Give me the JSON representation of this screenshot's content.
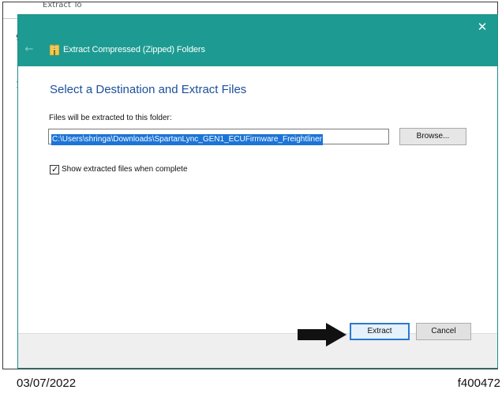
{
  "background": {
    "tab_text": "Extract To",
    "left_edge_chars": [
      "9",
      "1"
    ],
    "right_edge_char": "a"
  },
  "dialog": {
    "title": "Extract Compressed (Zipped) Folders",
    "close_symbol": "✕",
    "back_symbol": "←",
    "accent_color": "#1d9b92",
    "heading": "Select a Destination and Extract Files",
    "folder_label": "Files will be extracted to this folder:",
    "path_value": "C:\\Users\\shringa\\Downloads\\SpartanLync_GEN1_ECUFirmware_Freightliner",
    "browse_label": "Browse...",
    "show_files_label": "Show extracted files when complete",
    "show_files_checked": true,
    "extract_label": "Extract",
    "cancel_label": "Cancel"
  },
  "caption": {
    "date": "03/07/2022",
    "figure_id": "f400472"
  }
}
